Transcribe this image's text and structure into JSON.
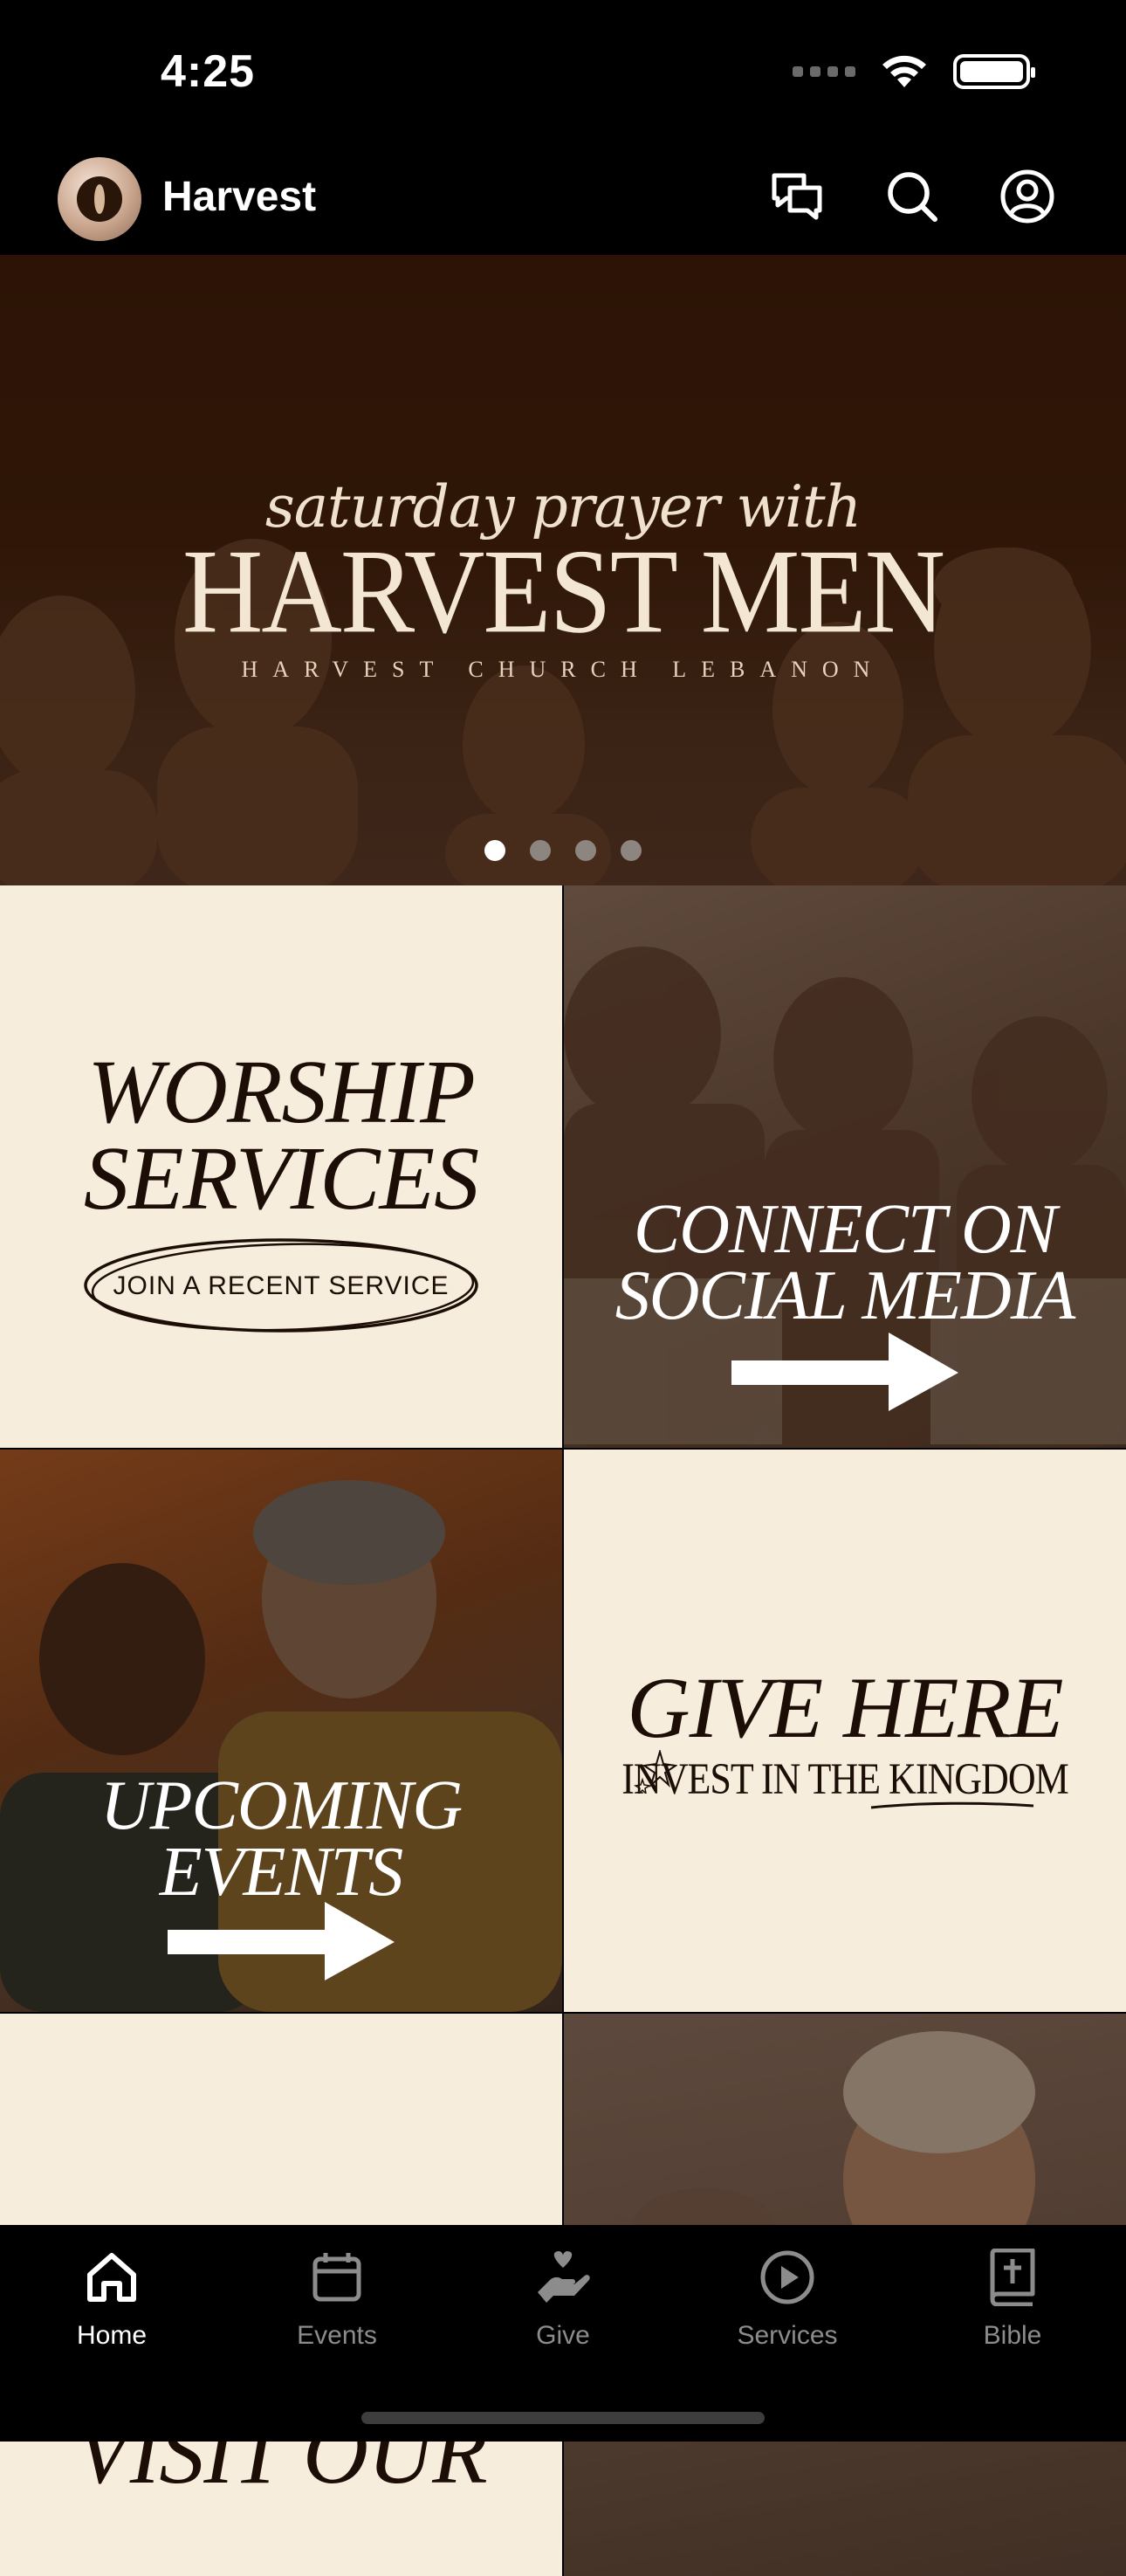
{
  "status_bar": {
    "time": "4:25"
  },
  "header": {
    "app_title": "Harvest"
  },
  "hero": {
    "script_text": "saturday prayer with",
    "title": "HARVEST MEN",
    "subtitle": "HARVEST CHURCH LEBANON",
    "slide_count": 4,
    "active_slide": 1
  },
  "tiles": {
    "worship": {
      "title_line1": "WORSHIP",
      "title_line2": "SERVICES",
      "button_label": "JOIN A RECENT SERVICE"
    },
    "social": {
      "title_line1": "CONNECT ON",
      "title_line2": "SOCIAL MEDIA"
    },
    "events": {
      "title_line1": "UPCOMING",
      "title_line2": "EVENTS"
    },
    "give": {
      "title": "GIVE HERE",
      "subtitle": "INVEST IN THE KINGDOM"
    },
    "visit": {
      "title": "VISIT OUR"
    }
  },
  "tab_bar": {
    "tabs": [
      {
        "label": "Home",
        "icon": "home-icon",
        "active": true
      },
      {
        "label": "Events",
        "icon": "calendar-icon",
        "active": false
      },
      {
        "label": "Give",
        "icon": "give-icon",
        "active": false
      },
      {
        "label": "Services",
        "icon": "play-icon",
        "active": false
      },
      {
        "label": "Bible",
        "icon": "bible-icon",
        "active": false
      }
    ]
  },
  "colors": {
    "cream": "#f6eddc",
    "hero_bg": "#2c1305",
    "dark_text": "#1c0e06"
  }
}
